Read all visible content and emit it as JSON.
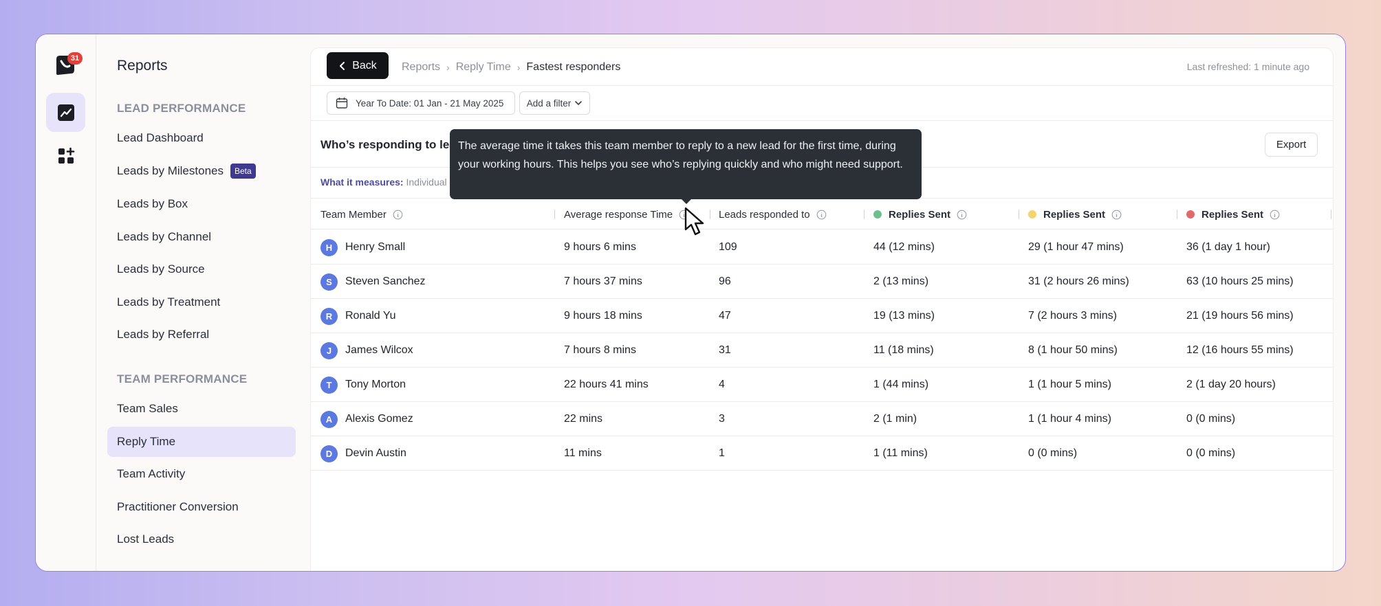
{
  "rail": {
    "badge_count": "31"
  },
  "sidebar": {
    "title": "Reports",
    "sections": [
      {
        "title": "LEAD PERFORMANCE"
      },
      {
        "title": "TEAM PERFORMANCE"
      }
    ],
    "lead_items": [
      {
        "label": "Lead Dashboard"
      },
      {
        "label": "Leads by Milestones",
        "badge": "Beta"
      },
      {
        "label": "Leads by Box"
      },
      {
        "label": "Leads by Channel"
      },
      {
        "label": "Leads by Source"
      },
      {
        "label": "Leads by Treatment"
      },
      {
        "label": "Leads by Referral"
      }
    ],
    "team_items": [
      {
        "label": "Team Sales"
      },
      {
        "label": "Reply Time",
        "active": true
      },
      {
        "label": "Team Activity"
      },
      {
        "label": "Practitioner Conversion"
      },
      {
        "label": "Lost Leads"
      }
    ]
  },
  "header": {
    "back_label": "Back",
    "breadcrumbs": [
      "Reports",
      "Reply Time",
      "Fastest responders"
    ],
    "last_refreshed": "Last refreshed: 1 minute ago"
  },
  "filters": {
    "date_range": "Year To Date: 01 Jan - 21 May 2025",
    "add_filter": "Add a filter"
  },
  "card": {
    "title": "Who’s responding to leads",
    "export_label": "Export",
    "measures_label": "What it measures:",
    "measures_text": "Individual"
  },
  "tooltip": {
    "text": "The average time it takes this team member to reply to a new lead for the first time, during your working hours. This helps you see who’s replying quickly and who might need support."
  },
  "colors": {
    "accent": "#e6e3fb",
    "dot_green": "#6fbf8e",
    "dot_yellow": "#f4d46e",
    "dot_red": "#e06a6a",
    "avatar": "#5b79e0"
  },
  "table": {
    "columns": [
      {
        "label": "Team Member"
      },
      {
        "label": "Average response Time"
      },
      {
        "label": "Leads responded to"
      },
      {
        "label": "Replies Sent",
        "dot": "green"
      },
      {
        "label": "Replies Sent",
        "dot": "yellow"
      },
      {
        "label": "Replies Sent",
        "dot": "red"
      }
    ],
    "rows": [
      {
        "initial": "H",
        "name": "Henry Small",
        "avg": "9 hours 6 mins",
        "leads": "109",
        "green": "44 (12 mins)",
        "yellow": "29 (1 hour 47 mins)",
        "red": "36 (1 day 1 hour)"
      },
      {
        "initial": "S",
        "name": "Steven Sanchez",
        "avg": "7 hours 37 mins",
        "leads": "96",
        "green": "2 (13 mins)",
        "yellow": "31 (2 hours 26 mins)",
        "red": "63 (10 hours 25 mins)"
      },
      {
        "initial": "R",
        "name": "Ronald Yu",
        "avg": "9 hours 18 mins",
        "leads": "47",
        "green": "19 (13 mins)",
        "yellow": "7 (2 hours 3 mins)",
        "red": "21 (19 hours 56 mins)"
      },
      {
        "initial": "J",
        "name": "James Wilcox",
        "avg": "7 hours 8 mins",
        "leads": "31",
        "green": "11 (18 mins)",
        "yellow": "8 (1 hour 50 mins)",
        "red": "12 (16 hours 55 mins)"
      },
      {
        "initial": "T",
        "name": "Tony Morton",
        "avg": "22 hours 41 mins",
        "leads": "4",
        "green": "1 (44 mins)",
        "yellow": "1 (1 hour 5 mins)",
        "red": "2 (1 day 20 hours)"
      },
      {
        "initial": "A",
        "name": "Alexis Gomez",
        "avg": "22 mins",
        "leads": "3",
        "green": "2 (1 min)",
        "yellow": "1 (1 hour 4 mins)",
        "red": "0 (0 mins)"
      },
      {
        "initial": "D",
        "name": "Devin Austin",
        "avg": "11 mins",
        "leads": "1",
        "green": "1 (11 mins)",
        "yellow": "0 (0 mins)",
        "red": "0 (0 mins)"
      }
    ]
  }
}
